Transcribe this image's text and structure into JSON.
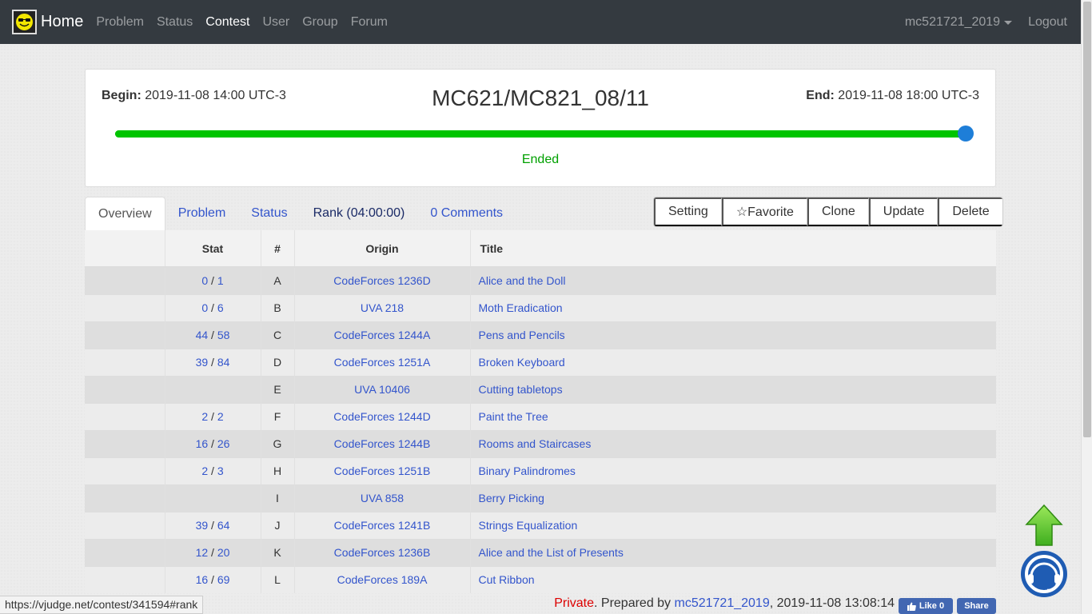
{
  "navbar": {
    "brand": "Home",
    "links": [
      "Problem",
      "Status",
      "Contest",
      "User",
      "Group",
      "Forum"
    ],
    "active": "Contest",
    "user": "mc521721_2019",
    "logout": "Logout"
  },
  "contest": {
    "begin_label": "Begin:",
    "begin_value": "2019-11-08 14:00 UTC-3",
    "end_label": "End:",
    "end_value": "2019-11-08 18:00 UTC-3",
    "title": "MC621/MC821_08/11",
    "progress_fraction": 1.0,
    "status": "Ended",
    "progress_color": "#00c400",
    "status_color": "#00a000"
  },
  "tabs": {
    "overview": "Overview",
    "problem": "Problem",
    "status": "Status",
    "rank": "Rank (04:00:00)",
    "comments": "0 Comments"
  },
  "actions": {
    "setting": "Setting",
    "favorite": "☆Favorite",
    "clone": "Clone",
    "update": "Update",
    "delete": "Delete"
  },
  "table": {
    "headers": {
      "stat": "Stat",
      "num": "#",
      "origin": "Origin",
      "title": "Title"
    },
    "rows": [
      {
        "solved": "0",
        "tried": "1",
        "num": "A",
        "origin": "CodeForces 1236D",
        "title": "Alice and the Doll"
      },
      {
        "solved": "0",
        "tried": "6",
        "num": "B",
        "origin": "UVA 218",
        "title": "Moth Eradication"
      },
      {
        "solved": "44",
        "tried": "58",
        "num": "C",
        "origin": "CodeForces 1244A",
        "title": "Pens and Pencils"
      },
      {
        "solved": "39",
        "tried": "84",
        "num": "D",
        "origin": "CodeForces 1251A",
        "title": "Broken Keyboard"
      },
      {
        "solved": "",
        "tried": "",
        "num": "E",
        "origin": "UVA 10406",
        "title": "Cutting tabletops"
      },
      {
        "solved": "2",
        "tried": "2",
        "num": "F",
        "origin": "CodeForces 1244D",
        "title": "Paint the Tree"
      },
      {
        "solved": "16",
        "tried": "26",
        "num": "G",
        "origin": "CodeForces 1244B",
        "title": "Rooms and Staircases"
      },
      {
        "solved": "2",
        "tried": "3",
        "num": "H",
        "origin": "CodeForces 1251B",
        "title": "Binary Palindromes"
      },
      {
        "solved": "",
        "tried": "",
        "num": "I",
        "origin": "UVA 858",
        "title": "Berry Picking"
      },
      {
        "solved": "39",
        "tried": "64",
        "num": "J",
        "origin": "CodeForces 1241B",
        "title": "Strings Equalization"
      },
      {
        "solved": "12",
        "tried": "20",
        "num": "K",
        "origin": "CodeForces 1236B",
        "title": "Alice and the List of Presents"
      },
      {
        "solved": "16",
        "tried": "69",
        "num": "L",
        "origin": "CodeForces 189A",
        "title": "Cut Ribbon"
      }
    ]
  },
  "footer": {
    "url": "https://vjudge.net/contest/341594#rank",
    "private": "Private",
    "prepared_by": ". Prepared by ",
    "author": "mc521721_2019",
    "timestamp": ", 2019-11-08 13:08:14",
    "like": "Like 0",
    "share": "Share"
  },
  "icons": {
    "logo": "smiley-sunglasses-icon",
    "scroll_top": "up-arrow-icon",
    "support": "headset-support-icon",
    "like": "thumbs-up-icon"
  }
}
